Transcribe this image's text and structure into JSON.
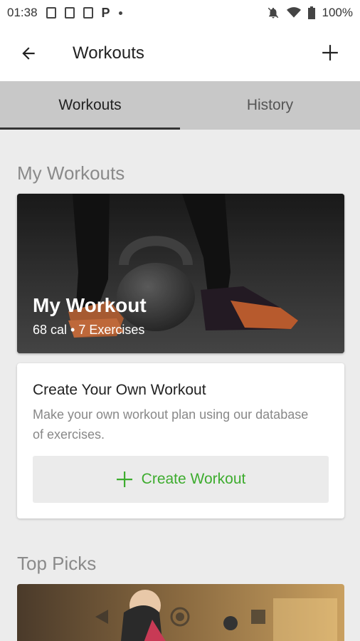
{
  "status": {
    "time": "01:38",
    "battery": "100%"
  },
  "appbar": {
    "title": "Workouts",
    "back_icon": "arrow-left-icon",
    "add_icon": "plus-icon"
  },
  "tabs": [
    {
      "label": "Workouts",
      "active": true
    },
    {
      "label": "History",
      "active": false
    }
  ],
  "my_workouts": {
    "section_title": "My Workouts",
    "card": {
      "title": "My Workout",
      "subtitle": "68 cal • 7 Exercises"
    }
  },
  "create": {
    "title": "Create Your Own Workout",
    "description": "Make your own workout plan using our database of exercises.",
    "button_label": "Create Workout",
    "accent": "#3dac2e"
  },
  "top_picks": {
    "section_title": "Top Picks"
  }
}
